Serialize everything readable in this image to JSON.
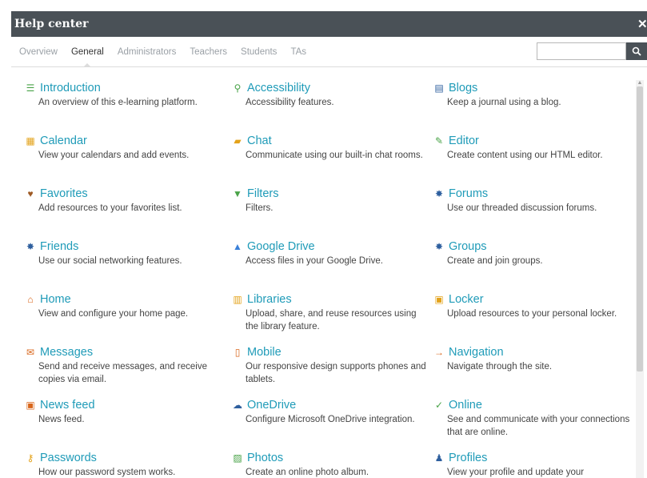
{
  "window": {
    "title": "Help center",
    "close_label": "✕"
  },
  "tabs": [
    {
      "label": "Overview"
    },
    {
      "label": "General"
    },
    {
      "label": "Administrators"
    },
    {
      "label": "Teachers"
    },
    {
      "label": "Students"
    },
    {
      "label": "TAs"
    }
  ],
  "active_tab": "General",
  "search": {
    "value": "",
    "placeholder": "",
    "icon": "search-icon"
  },
  "items": [
    {
      "name": "Introduction",
      "desc": "An overview of this e-learning platform.",
      "icon": "list-icon",
      "glyph": "☰",
      "color": "#49a348"
    },
    {
      "name": "Accessibility",
      "desc": "Accessibility features.",
      "icon": "magnifier-icon",
      "glyph": "⚲",
      "color": "#49a348"
    },
    {
      "name": "Blogs",
      "desc": "Keep a journal using a blog.",
      "icon": "book-icon",
      "glyph": "▤",
      "color": "#2e5f9e"
    },
    {
      "name": "Calendar",
      "desc": "View your calendars and add events.",
      "icon": "calendar-icon",
      "glyph": "▦",
      "color": "#e3a21a"
    },
    {
      "name": "Chat",
      "desc": "Communicate using our built-in chat rooms.",
      "icon": "chat-icon",
      "glyph": "▰",
      "color": "#e3a21a"
    },
    {
      "name": "Editor",
      "desc": "Create content using our HTML editor.",
      "icon": "pencil-icon",
      "glyph": "✎",
      "color": "#49a348"
    },
    {
      "name": "Favorites",
      "desc": "Add resources to your favorites list.",
      "icon": "heart-icon",
      "glyph": "♥",
      "color": "#9e5a24"
    },
    {
      "name": "Filters",
      "desc": "Filters.",
      "icon": "filter-icon",
      "glyph": "▼",
      "color": "#49a348"
    },
    {
      "name": "Forums",
      "desc": "Use our threaded discussion forums.",
      "icon": "forums-icon",
      "glyph": "✸",
      "color": "#2e5f9e"
    },
    {
      "name": "Friends",
      "desc": "Use our social networking features.",
      "icon": "friends-icon",
      "glyph": "✸",
      "color": "#2e5f9e"
    },
    {
      "name": "Google Drive",
      "desc": "Access files in your Google Drive.",
      "icon": "google-drive-icon",
      "glyph": "▲",
      "color": "#3a80d8"
    },
    {
      "name": "Groups",
      "desc": "Create and join groups.",
      "icon": "groups-icon",
      "glyph": "✸",
      "color": "#2e5f9e"
    },
    {
      "name": "Home",
      "desc": "View and configure your home page.",
      "icon": "home-icon",
      "glyph": "⌂",
      "color": "#d8661b"
    },
    {
      "name": "Libraries",
      "desc": "Upload, share, and reuse resources using the library feature.",
      "icon": "libraries-icon",
      "glyph": "▥",
      "color": "#e3a21a"
    },
    {
      "name": "Locker",
      "desc": "Upload resources to your personal locker.",
      "icon": "locker-icon",
      "glyph": "▣",
      "color": "#e3a21a"
    },
    {
      "name": "Messages",
      "desc": "Send and receive messages, and receive copies via email.",
      "icon": "messages-icon",
      "glyph": "✉",
      "color": "#d8661b"
    },
    {
      "name": "Mobile",
      "desc": "Our responsive design supports phones and tablets.",
      "icon": "mobile-icon",
      "glyph": "▯",
      "color": "#d8661b"
    },
    {
      "name": "Navigation",
      "desc": "Navigate through the site.",
      "icon": "arrow-right-icon",
      "glyph": "→",
      "color": "#d8661b"
    },
    {
      "name": "News feed",
      "desc": "News feed.",
      "icon": "news-feed-icon",
      "glyph": "▣",
      "color": "#d8661b"
    },
    {
      "name": "OneDrive",
      "desc": "Configure Microsoft OneDrive integration.",
      "icon": "cloud-icon",
      "glyph": "☁",
      "color": "#2e5f9e"
    },
    {
      "name": "Online",
      "desc": "See and communicate with your connections that are online.",
      "icon": "checkmark-icon",
      "glyph": "✓",
      "color": "#49a348"
    },
    {
      "name": "Passwords",
      "desc": "How our password system works.",
      "icon": "key-icon",
      "glyph": "⚷",
      "color": "#e3a21a"
    },
    {
      "name": "Photos",
      "desc": "Create an online photo album.",
      "icon": "photo-icon",
      "glyph": "▨",
      "color": "#49a348"
    },
    {
      "name": "Profiles",
      "desc": "View your profile and update your",
      "icon": "profile-icon",
      "glyph": "♟",
      "color": "#2e5f9e"
    }
  ]
}
